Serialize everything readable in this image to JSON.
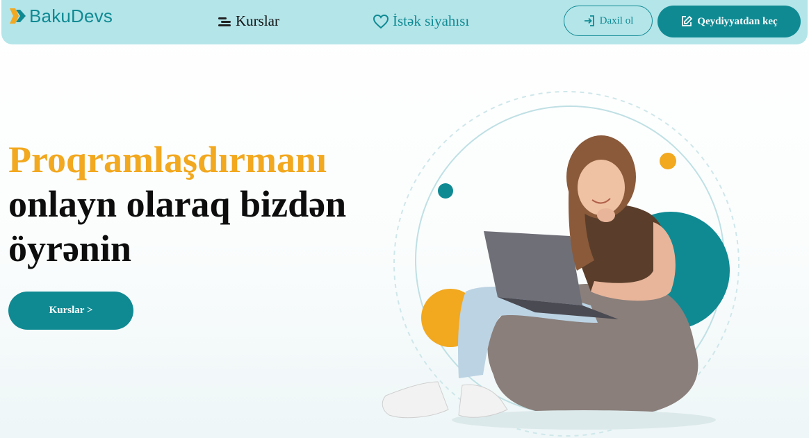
{
  "brand": {
    "name": "BakuDevs",
    "logo_colors": [
      "#f2a81f",
      "#0f8a93"
    ]
  },
  "nav": {
    "courses_label": "Kurslar",
    "courses_icon": "menu-bars-icon",
    "wishlist_label": "İstək siyahısı",
    "wishlist_icon": "heart-icon"
  },
  "auth": {
    "login_label": "Daxil ol",
    "login_icon": "sign-in-icon",
    "register_label": "Qeydiyyatdan keç",
    "register_icon": "edit-icon"
  },
  "hero": {
    "title_accent": "Proqramlaşdırmanı",
    "title_line2": "onlayn olaraq bizdən",
    "title_line3": "öyrənin",
    "cta_label": "Kurslar >"
  },
  "colors": {
    "primary": "#0f8a93",
    "accent": "#f2a81f",
    "navbar_bg": "#b4e5e9",
    "text_dark": "#0d0d0d"
  }
}
